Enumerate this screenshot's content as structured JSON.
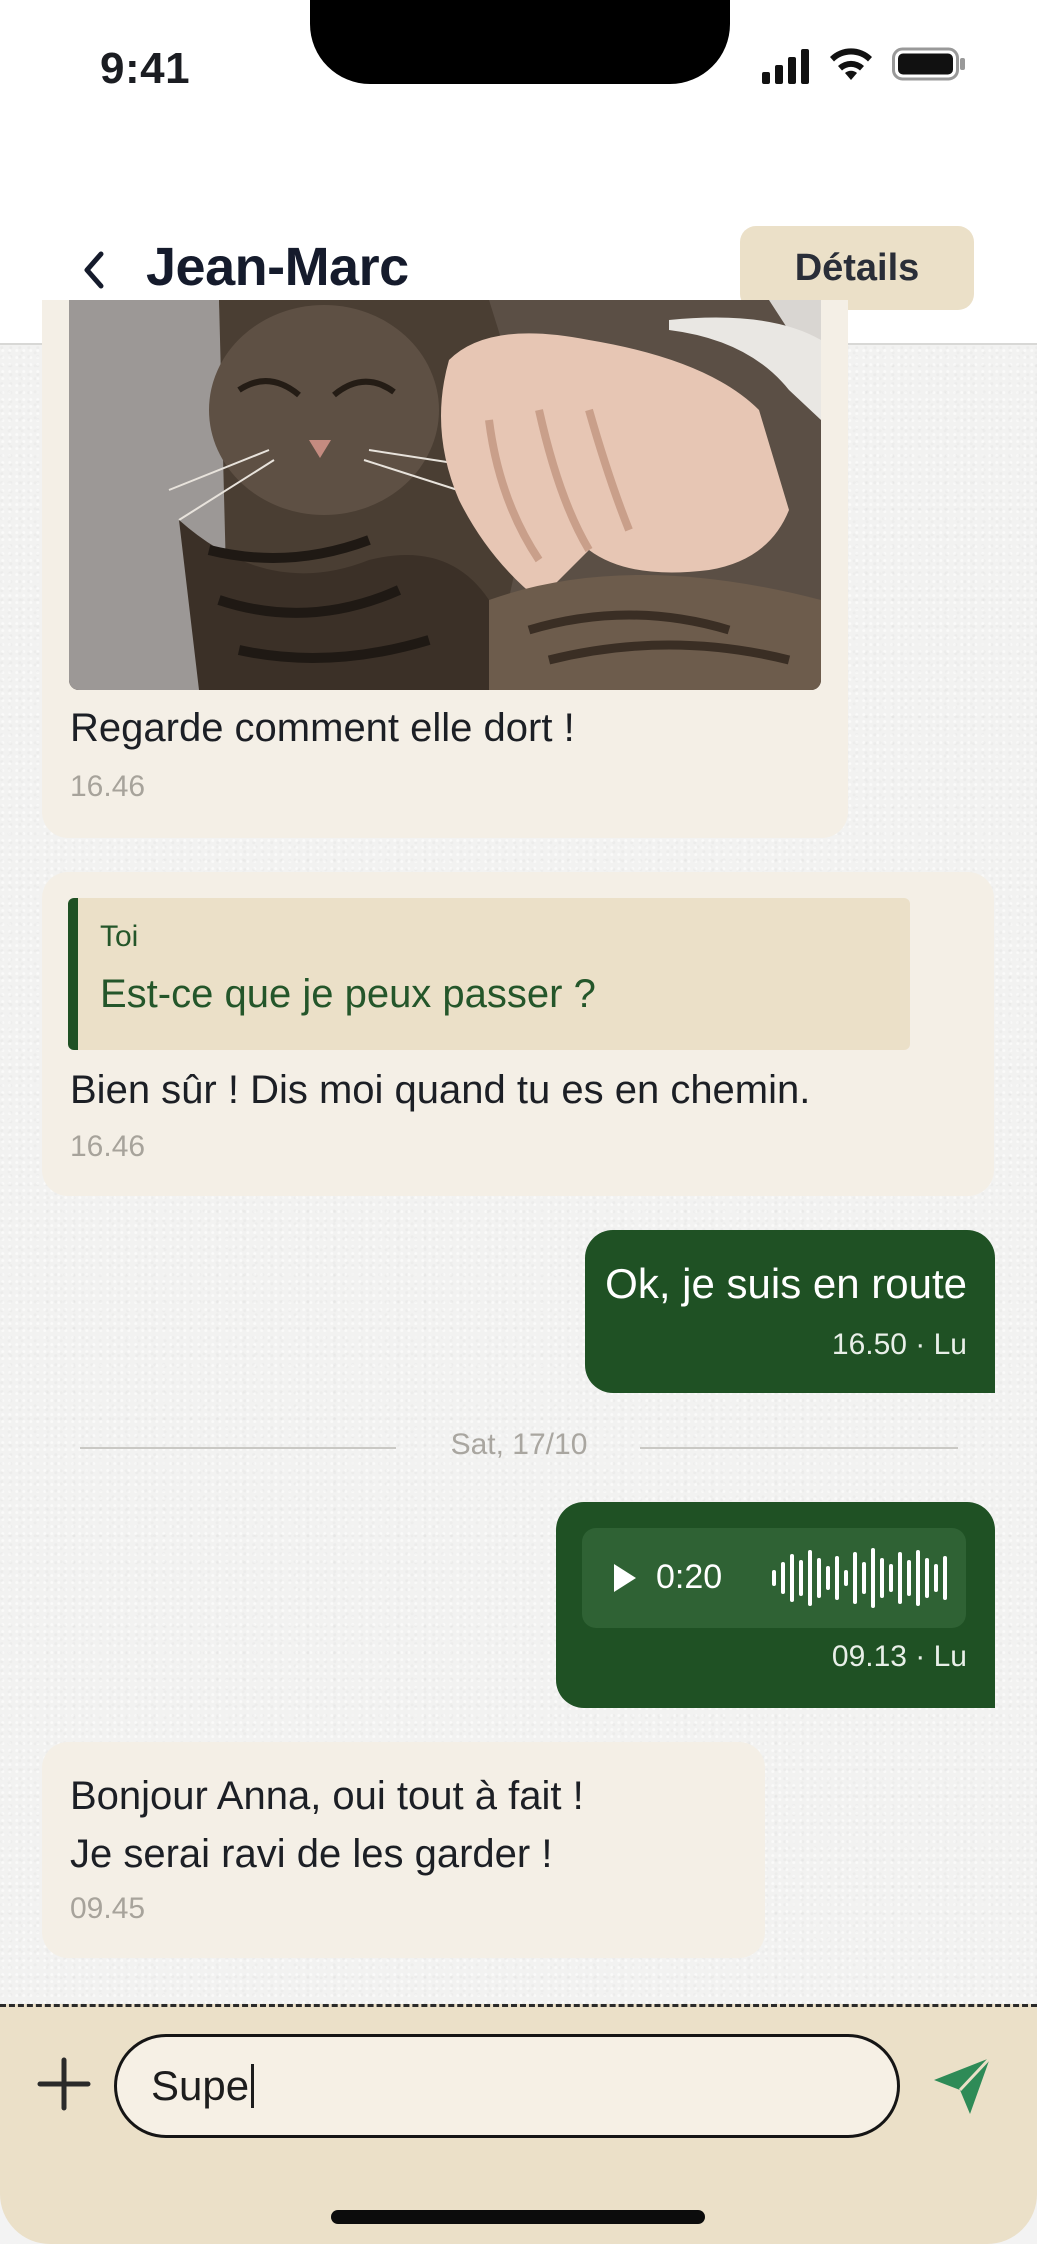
{
  "status_bar": {
    "time": "9:41"
  },
  "header": {
    "title": "Jean-Marc",
    "details_label": "Détails"
  },
  "messages": {
    "photo": {
      "caption": "Regarde comment elle dort !",
      "time": "16.46"
    },
    "reply": {
      "quote_author": "Toi",
      "quote_text": "Est-ce que je peux passer ?",
      "text": "Bien sûr ! Dis moi quand tu es en chemin.",
      "time": "16.46"
    },
    "out_text": {
      "text": "Ok, je suis en route",
      "meta": "16.50 · Lu"
    },
    "date_separator": "Sat, 17/10",
    "out_audio": {
      "duration": "0:20",
      "meta": "09.13 · Lu"
    },
    "last": {
      "line1": "Bonjour Anna, oui tout à fait !",
      "line2": "Je serai ravi de les garder !",
      "time": "09.45"
    }
  },
  "composer": {
    "input_value": "Supe"
  },
  "colors": {
    "accent_green": "#1f5124",
    "beige": "#ebe0c8",
    "bubble_in": "#f4efe6",
    "send_green": "#2e8b57"
  }
}
